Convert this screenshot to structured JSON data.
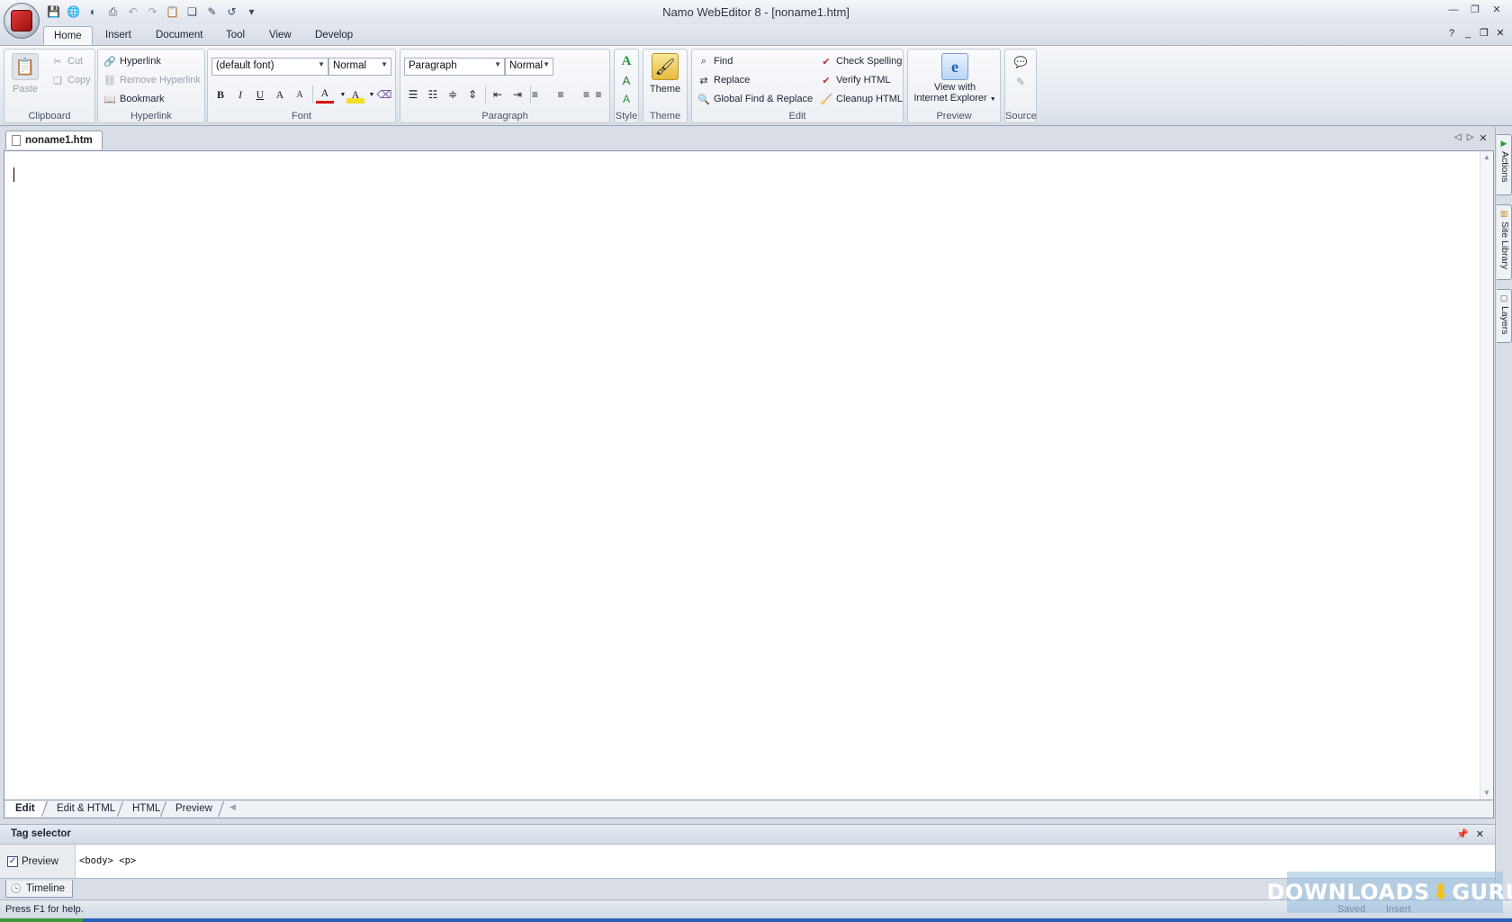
{
  "window": {
    "title": "Namo WebEditor 8 - [noname1.htm]",
    "controls": [
      "—",
      "❐",
      "✕"
    ]
  },
  "quick_access": [
    {
      "icon": "save-icon",
      "glyph": "💾"
    },
    {
      "icon": "publish-icon",
      "glyph": "🌐"
    },
    {
      "icon": "preview-icon",
      "glyph": "◐"
    },
    {
      "icon": "print-icon",
      "glyph": "⎙"
    },
    {
      "icon": "undo-disabled-icon",
      "glyph": "↶"
    },
    {
      "icon": "redo-disabled-icon",
      "glyph": "↷"
    },
    {
      "icon": "paste-icon",
      "glyph": "📋"
    },
    {
      "icon": "copy-icon",
      "glyph": "❏"
    },
    {
      "icon": "edit-icon",
      "glyph": "✎"
    },
    {
      "icon": "undo-icon",
      "glyph": "↺"
    },
    {
      "icon": "customize-icon",
      "glyph": "▾"
    }
  ],
  "ribbon_tabs": [
    "Home",
    "Insert",
    "Document",
    "Tool",
    "View",
    "Develop"
  ],
  "active_tab": "Home",
  "ribbon": {
    "clipboard": {
      "label": "Clipboard",
      "paste": "Paste",
      "cut": "Cut",
      "copy": "Copy"
    },
    "hyperlink": {
      "label": "Hyperlink",
      "hyperlink": "Hyperlink",
      "remove": "Remove Hyperlink",
      "bookmark": "Bookmark"
    },
    "font": {
      "label": "Font",
      "font_name": "(default font)",
      "font_size": "Normal",
      "buttons": [
        {
          "name": "bold-button",
          "glyph": "B"
        },
        {
          "name": "italic-button",
          "glyph": "I"
        },
        {
          "name": "underline-button",
          "glyph": "U"
        },
        {
          "name": "grow-font-button",
          "glyph": "A"
        },
        {
          "name": "shrink-font-button",
          "glyph": "A"
        },
        {
          "name": "font-color-button",
          "glyph": "A"
        },
        {
          "name": "highlight-button",
          "glyph": "A"
        },
        {
          "name": "clear-format-button",
          "glyph": "⌫"
        }
      ]
    },
    "paragraph": {
      "label": "Paragraph",
      "style": "Paragraph",
      "size": "Normal",
      "buttons": [
        {
          "name": "numbered-list-button",
          "glyph": "☰"
        },
        {
          "name": "bullet-list-button",
          "glyph": "☷"
        },
        {
          "name": "line-spacing-button",
          "glyph": "≑"
        },
        {
          "name": "paragraph-spacing-button",
          "glyph": "⇕"
        },
        {
          "name": "outdent-button",
          "glyph": "⇤"
        },
        {
          "name": "indent-button",
          "glyph": "⇥"
        },
        {
          "name": "align-left-button",
          "glyph": "≡"
        },
        {
          "name": "align-center-button",
          "glyph": "≡"
        },
        {
          "name": "align-right-button",
          "glyph": "≡"
        },
        {
          "name": "justify-button",
          "glyph": "≡"
        }
      ]
    },
    "style": {
      "label": "Style"
    },
    "theme": {
      "label": "Theme",
      "button": "Theme"
    },
    "edit": {
      "label": "Edit",
      "find": "Find",
      "replace": "Replace",
      "global": "Global Find & Replace",
      "check_spelling": "Check Spelling",
      "verify": "Verify HTML",
      "cleanup": "Cleanup HTML"
    },
    "preview": {
      "label": "Preview",
      "line1": "View with",
      "line2": "Internet Explorer"
    },
    "source": {
      "label": "Source"
    }
  },
  "document_tab": "noname1.htm",
  "view_tabs": [
    "Edit",
    "Edit & HTML",
    "HTML",
    "Preview"
  ],
  "active_view": "Edit",
  "tag_selector": {
    "title": "Tag selector",
    "preview_label": "Preview",
    "preview_checked": true,
    "path": "<body> <p>"
  },
  "timeline_tab": "Timeline",
  "status": {
    "help": "Press F1 for help.",
    "saved": "Saved",
    "mode": "Insert"
  },
  "side_panels": [
    "Actions",
    "Site Library",
    "Layers"
  ],
  "watermark": {
    "left": "DOWNLOADS",
    "right": "GURU"
  }
}
